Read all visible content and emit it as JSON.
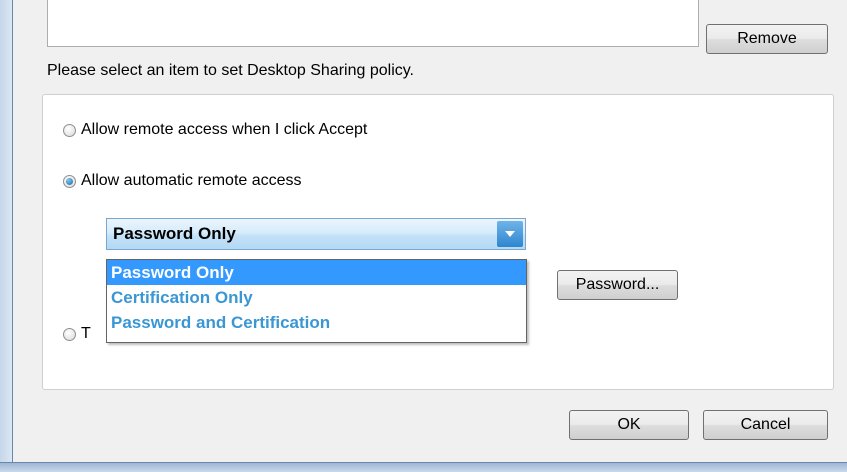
{
  "buttons": {
    "remove": "Remove",
    "ok": "OK",
    "cancel": "Cancel",
    "password": "Password..."
  },
  "instruction": "Please select an item to set Desktop Sharing policy.",
  "radios": [
    {
      "label": "Allow remote access when I click Accept",
      "checked": false
    },
    {
      "label": "Allow automatic remote access",
      "checked": true
    },
    {
      "label": "T",
      "checked": false
    }
  ],
  "combo": {
    "selected": "Password Only",
    "options": [
      "Password Only",
      "Certification Only",
      "Password and Certification"
    ]
  },
  "colors": {
    "accent": "#3399ff",
    "option_text": "#3a97d4"
  }
}
